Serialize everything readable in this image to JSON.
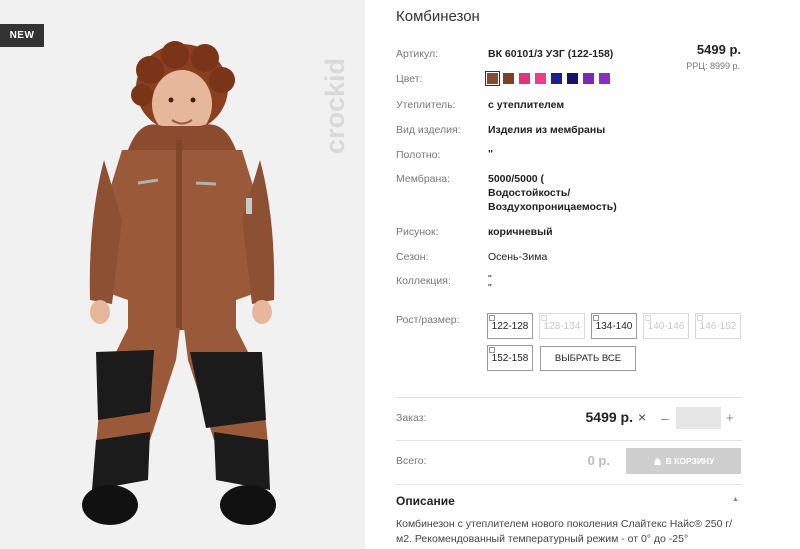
{
  "badge": "NEW",
  "brand": "crockid",
  "product": {
    "title": "Комбинезон",
    "price": "5499 р.",
    "rrp": "РРЦ: 8999 р."
  },
  "specs": {
    "article_label": "Артикул:",
    "article_value": "ВК 60101/3 УЗГ (122-158)",
    "color_label": "Цвет:",
    "insulation_label": "Утеплитель:",
    "insulation_value": "с утеплителем",
    "type_label": "Вид изделия:",
    "type_value": "Изделия из мембраны",
    "fabric_label": "Полотно:",
    "fabric_value": "\"",
    "membrane_label": "Мембрана:",
    "membrane_line1": "5000/5000 (",
    "membrane_line2": "Водостойкость/",
    "membrane_line3": "Воздухопроницаемость)",
    "pattern_label": "Рисунок:",
    "pattern_value": "коричневый",
    "season_label": "Сезон:",
    "season_value": "Осень-Зима",
    "collection_label": "Коллекция:",
    "collection_value_1": "\"",
    "collection_value_2": "\"",
    "size_label": "Рост/размер:"
  },
  "swatches": [
    {
      "color": "#8a4a2e",
      "selected": true
    },
    {
      "color": "#7b3f2a",
      "selected": false
    },
    {
      "color": "#e2347c",
      "selected": false
    },
    {
      "color": "#ec3e8a",
      "selected": false
    },
    {
      "color": "#1e1f8c",
      "selected": false
    },
    {
      "color": "#141370",
      "selected": false
    },
    {
      "color": "#7c2bb0",
      "selected": false
    },
    {
      "color": "#8a2fc0",
      "selected": false
    }
  ],
  "sizes": [
    {
      "label": "122-128",
      "enabled": true
    },
    {
      "label": "128-134",
      "enabled": false
    },
    {
      "label": "134-140",
      "enabled": true
    },
    {
      "label": "140-146",
      "enabled": false
    },
    {
      "label": "146-152",
      "enabled": false
    },
    {
      "label": "152-158",
      "enabled": true
    }
  ],
  "select_all": "ВЫБРАТЬ ВСЕ",
  "order": {
    "label": "Заказ:",
    "price": "5499 р.",
    "times": "×",
    "minus": "–",
    "plus": "+",
    "qty": ""
  },
  "total": {
    "label": "Всего:",
    "value": "0 р.",
    "cart_button": "В КОРЗИНУ"
  },
  "description": {
    "title": "Описание",
    "text": "Комбинезон с утеплителем нового поколения Слайтекс Найс® 250 г/м2. Рекомендованный температурный режим - от 0° до -25°"
  },
  "colors": {
    "suit": "#9a5a3a",
    "suit_dark": "#7e4529",
    "panel_black": "#1b1b1b",
    "background": "#f1f1f1"
  }
}
